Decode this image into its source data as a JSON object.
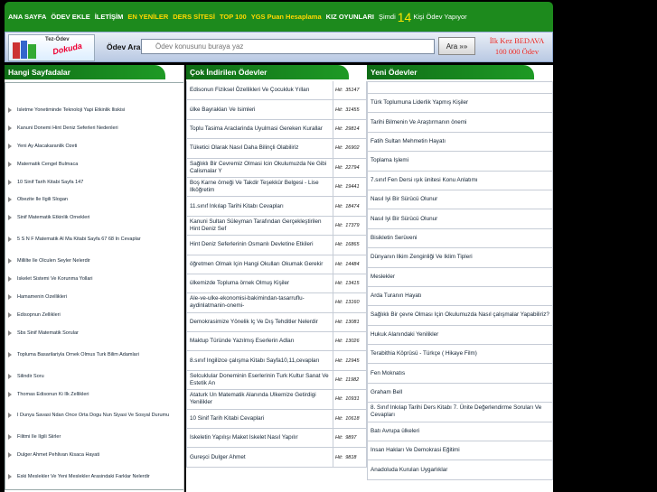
{
  "topnav": {
    "items": [
      "ANA SAYFA",
      "ÖDEV EKLE",
      "İLETİŞİM",
      "EN YENİLER",
      "DERS SİTESİ",
      "TOP 100",
      "YGS Puan Hesaplama",
      "KIZ OYUNLARI"
    ],
    "online_prefix": "Şimdi",
    "online_count": "14",
    "online_suffix": "Kişi Ödev Yapıyor"
  },
  "search": {
    "label": "Ödev Ara",
    "placeholder": "Ödev konusunu buraya yaz",
    "button": "Ara »»"
  },
  "logo": {
    "line1": "Tez-Ödev",
    "line2": "Dokuda"
  },
  "promo": {
    "line1": "İlk Kez BEDAVA",
    "line2": "100 000 Ödev"
  },
  "col1": {
    "title": "Hangi Sayfadalar",
    "items": [
      "Isletme Yonetiminde Teknoloji Yapi Etkinlik Iliskisi",
      "Kanuni Donemi Hint Deniz Seferleri Nedenleri",
      "Yeni Ay Alacakaranlik Ozeti",
      "Matematik Cengel Bulmaca",
      "10 Sinif Tarih Kitabi Sayfa 147",
      "Obezite Ile Ilgili Slogan",
      "Sinif Matematik Etkinlik Ornekleri",
      "5 S N F Matematik Al Ma Kitabi Sayfa 67 68 In Cevaplar",
      "Millilte Ile Olculen Seyler Nelerdir",
      "Iskelet Sistemi Ve Korunma Yollari",
      "Hamamenin Ozellikleri",
      "Edisopnun Zellikleri",
      "Sbs Sinif Matematik Sorular",
      "Topluma Basarilariyla Ornek Olmus Turk Bilim Adamlari",
      "Silindir Soru",
      "Thomas Edisonun Ki Ilk Zellikleri",
      "I Dunya Savasi Ndan Once Orta Dogu Nun Siyasi Ve Sosyal Durumu",
      "Filitmi Ile Ilgili Siirler",
      "Dulger Ahmet Pehlivan Kisaca Hayati",
      "Eski Meslekler Ve Yeni Meslekler Arasindaki Farklar Nelerdir"
    ]
  },
  "col2": {
    "title": "Çok İndirilen Ödevler",
    "hit_prefix": "Hit:",
    "rows": [
      {
        "t": "Edisonun Fiziksel Özellikleri Ve Çocukluk Yılları",
        "h": "35147"
      },
      {
        "t": "ülke Bayrakları Ve Isimleri",
        "h": "31455"
      },
      {
        "t": "Toplu Tasima Araclarinda Uyulmasi Gereken Kurallar",
        "h": "29814"
      },
      {
        "t": "Tüketici Olarak Nasıl Daha Bilinçli Olabiliriz",
        "h": "26902"
      },
      {
        "t": "Sağlıklı Bir Cevremiz Olmasi Icin Okulumuzda Ne Gibi Calismalar Y",
        "h": "22794"
      },
      {
        "t": "Boş Karne örneği Ve Takdir Teşekkür Belgesi - Lise Ilköğretim",
        "h": "19441"
      },
      {
        "t": "11.sınıf Inkılap Tarihi Kitabı Cevapları",
        "h": "18474"
      },
      {
        "t": "Kanuni Sultan Süleyman Tarafından Gerçekleştirilen Hint Deniz Sef",
        "h": "17379"
      },
      {
        "t": "Hint Deniz Seferlerinin Osmanlı Devletine Etkileri",
        "h": "16865"
      },
      {
        "t": "öğretmen Olmak Için Hangi Okulları Okumak Gerekir",
        "h": "14484"
      },
      {
        "t": "ülkemizde Topluma örnek Olmuş Kişiler",
        "h": "13415"
      },
      {
        "t": "Ale-ve-ulke-ekonomisi-bakimindan-tasarruflu-aydinlatmanin-onemi-",
        "h": "13160"
      },
      {
        "t": "Demokrasimize Yönelik Iç Ve Dış Tehditler Nelerdir",
        "h": "13081"
      },
      {
        "t": "Maktup Türünde Yazılmış Eserlerin Adları",
        "h": "13026"
      },
      {
        "t": "8.sınıf Ingilizce çalışma Kitabı Sayfa10,11,cevapları",
        "h": "12945"
      },
      {
        "t": "Selcuklular Doneminin Eserlerinin Turk Kultur Sanat Ve Estetik An",
        "h": "11982"
      },
      {
        "t": "Ataturk Un Matematik Alanında Ulkemize Getirdigi Yenilikler",
        "h": "10931"
      },
      {
        "t": "10 Sinif Tarih Kitabi Cevaplari",
        "h": "10618"
      },
      {
        "t": "Iskeletin Yapılışı Maket Iskelet Nasıl Yapılır",
        "h": "9897"
      },
      {
        "t": "Gureşci Dulger Ahmet",
        "h": "9818"
      }
    ]
  },
  "col3": {
    "title": "Yeni Ödevler",
    "items": [
      "Türk Toplumuna Liderlik Yapmış Kişiler",
      "Tarihi Bilmenin Ve Araştırmanın önemi",
      "Fatih Sultan Mehmetin Hayatı",
      "Toplama Işlemi",
      "7.sınıf Fen Dersi ışık ünitesi Konu Anlatımı",
      "Nasıl Iyi Bir Sürücü Olunur",
      "Nasıl Iyi Bir Sürücü Olunur",
      "Bisikletin Serüveni",
      "Dünyanın Ilkim Zenginliği Ve Iklim Tipleri",
      "Meslekler",
      "Arda Turanın Hayatı",
      "Sağlıklı Bir çevre Olması Için Okulumuzda Nasıl çalışmalar Yapabiliriz?",
      "Hukuk Alanındaki Yenilikler",
      "Terabithia Köprüsü - Türkçe ( Hikaye Film)",
      "Fen Moknatıs",
      "Graham Bell",
      "8. Sınıf Inkılap Tarihi Ders Kitabı 7. Ünite Değerlendirme Soruları Ve Cevapları",
      "Batı Avrupa ülkeleri",
      "Insan Hakları Ve Demokrasi Eğitimi",
      "Anadoluda Kurulan Uygarlıklar"
    ]
  }
}
